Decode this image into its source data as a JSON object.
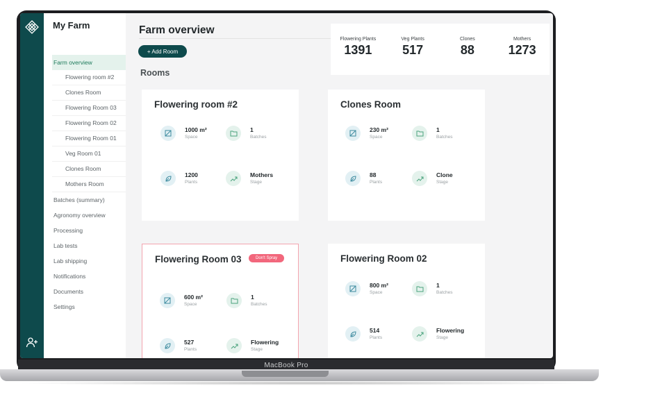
{
  "device": {
    "model_label": "MacBook Pro"
  },
  "brand": {
    "name": "My Farm"
  },
  "sidebar": {
    "items": [
      {
        "label": "Farm overview",
        "active": true,
        "level": "top"
      },
      {
        "label": "Flowering room #2",
        "level": "sub"
      },
      {
        "label": "Clones Room",
        "level": "sub"
      },
      {
        "label": "Flowering Room 03",
        "level": "sub"
      },
      {
        "label": "Flowering Room 02",
        "level": "sub"
      },
      {
        "label": "Flowering Room 01",
        "level": "sub"
      },
      {
        "label": "Veg Room 01",
        "level": "sub"
      },
      {
        "label": "Clones Room",
        "level": "sub"
      },
      {
        "label": "Mothers Room",
        "level": "sub"
      },
      {
        "label": "Batches (summary)",
        "level": "top"
      },
      {
        "label": "Agronomy overview",
        "level": "top"
      },
      {
        "label": "Processing",
        "level": "top"
      },
      {
        "label": "Lab tests",
        "level": "top"
      },
      {
        "label": "Lab shipping",
        "level": "top"
      },
      {
        "label": "Notifications",
        "level": "top"
      },
      {
        "label": "Documents",
        "level": "top"
      },
      {
        "label": "Settings",
        "level": "top"
      }
    ]
  },
  "main": {
    "title": "Farm overview",
    "add_room_label": "+ Add Room",
    "rooms_heading": "Rooms"
  },
  "stats": [
    {
      "label": "Flowering Plants",
      "value": "1391"
    },
    {
      "label": "Veg Plants",
      "value": "517"
    },
    {
      "label": "Clones",
      "value": "88"
    },
    {
      "label": "Mothers",
      "value": "1273"
    }
  ],
  "rooms": [
    {
      "name": "Flowering room #2",
      "space": "1000 m²",
      "space_label": "Space",
      "batches": "1",
      "batches_label": "Batches",
      "plants": "1200",
      "plants_label": "Plants",
      "stage": "Mothers",
      "stage_label": "Stage"
    },
    {
      "name": "Clones Room",
      "space": "230 m²",
      "space_label": "Space",
      "batches": "1",
      "batches_label": "Batches",
      "plants": "88",
      "plants_label": "Plants",
      "stage": "Clone",
      "stage_label": "Stage"
    },
    {
      "name": "Flowering Room 03",
      "badge": "Don't Spray",
      "space": "600 m²",
      "space_label": "Space",
      "batches": "1",
      "batches_label": "Batches",
      "plants": "527",
      "plants_label": "Plants",
      "stage": "Flowering",
      "stage_label": "Stage"
    },
    {
      "name": "Flowering Room 02",
      "space": "800 m²",
      "space_label": "Space",
      "batches": "1",
      "batches_label": "Batches",
      "plants": "514",
      "plants_label": "Plants",
      "stage": "Flowering",
      "stage_label": "Stage"
    }
  ],
  "icons": {
    "space": "area-icon",
    "batches": "folder-icon",
    "plants": "leaf-icon",
    "stage": "trend-up-icon"
  },
  "colors": {
    "rail": "#0e4a4c",
    "accent_green": "#4aa37d",
    "alert": "#f2677c"
  }
}
